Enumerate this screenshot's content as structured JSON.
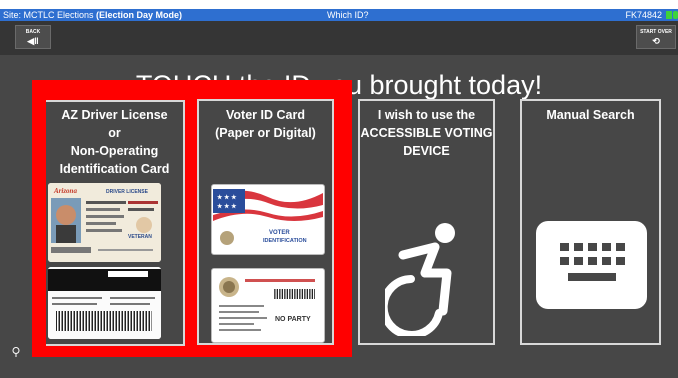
{
  "topbar": {
    "site_prefix": "Site: MCTLC Elections ",
    "site_mode": "(Election Day Mode)",
    "screen_title": "Which ID?",
    "station": "FK74842"
  },
  "nav": {
    "back_label": "BACK",
    "start_over_label": "START OVER"
  },
  "heading": "TOUCH the ID you brought today!",
  "options": [
    {
      "line1": "AZ Driver License",
      "line2": "or",
      "line3": "Non-Operating",
      "line4": "Identification Card"
    },
    {
      "line1": "Voter ID Card",
      "line2": "(Paper or Digital)"
    },
    {
      "line1": "I wish to use the",
      "line2": "ACCESSIBLE VOTING",
      "line3": "DEVICE"
    },
    {
      "line1": "Manual Search"
    }
  ],
  "card_images": {
    "az_front_state": "Arizona",
    "az_front_type": "DRIVER LICENSE",
    "az_front_tag": "VETERAN",
    "voter_card_text1": "VOTER",
    "voter_card_text2": "IDENTIFICATION",
    "voter_card_party": "NO PARTY"
  },
  "colors": {
    "topbar": "#2e6fd0",
    "background": "#474747",
    "highlight": "#ff0000",
    "status_green": "#3fd13a"
  }
}
